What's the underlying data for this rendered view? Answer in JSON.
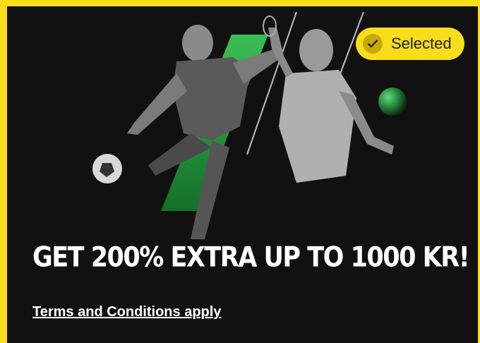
{
  "promo": {
    "selected_badge": {
      "label": "Selected",
      "icon": "checkmark-icon"
    },
    "headline": "GET 200% EXTRA UP TO 1000 KR!",
    "terms_link": "Terms and Conditions apply"
  },
  "colors": {
    "accent": "#f7dd1a",
    "background": "#111111",
    "brand_green": "#2fb34a",
    "text": "#ffffff"
  }
}
